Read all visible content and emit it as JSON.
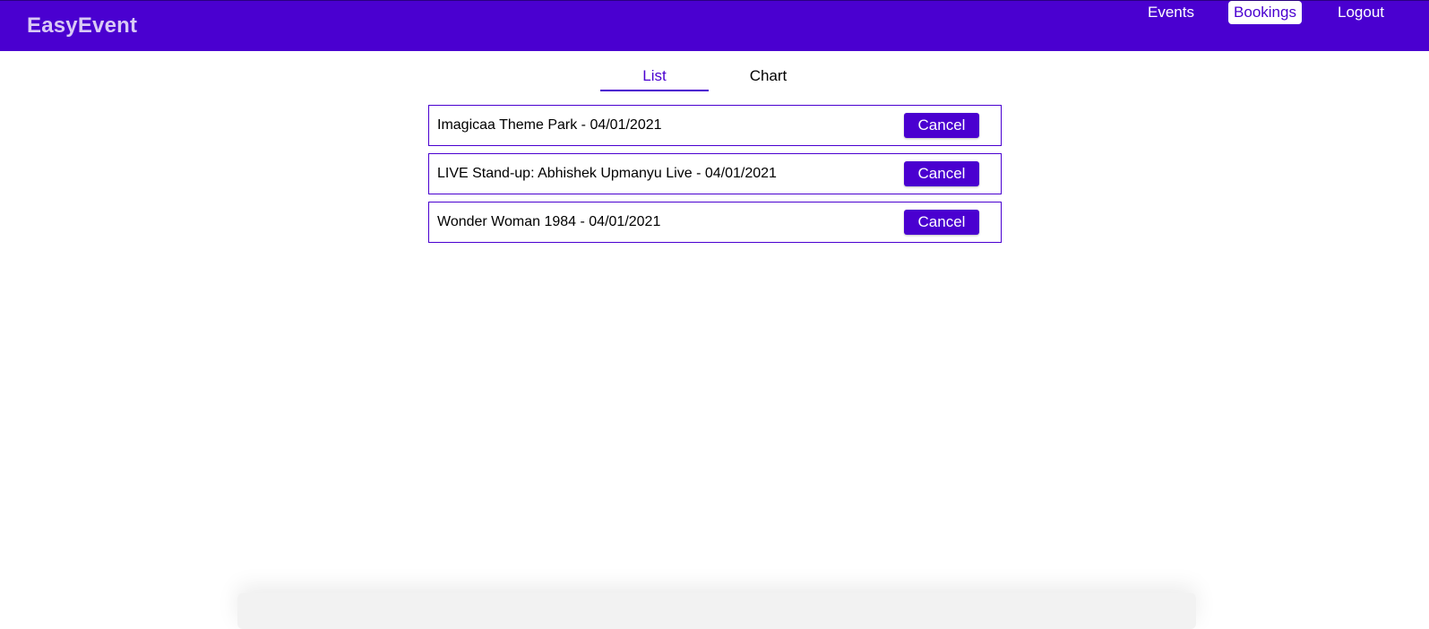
{
  "app": {
    "logo": "EasyEvent"
  },
  "nav": {
    "events": "Events",
    "bookings": "Bookings",
    "logout": "Logout",
    "active": "Bookings"
  },
  "tabs": {
    "list": "List",
    "chart": "Chart",
    "active": "List"
  },
  "bookings": [
    {
      "label": "Imagicaa Theme Park - 04/01/2021",
      "cancel_label": "Cancel"
    },
    {
      "label": "LIVE Stand-up: Abhishek Upmanyu Live - 04/01/2021",
      "cancel_label": "Cancel"
    },
    {
      "label": "Wonder Woman 1984 - 04/01/2021",
      "cancel_label": "Cancel"
    }
  ],
  "colors": {
    "brand": "#4a00d0",
    "logo": "#d9c9f5",
    "background": "#ffffff"
  }
}
